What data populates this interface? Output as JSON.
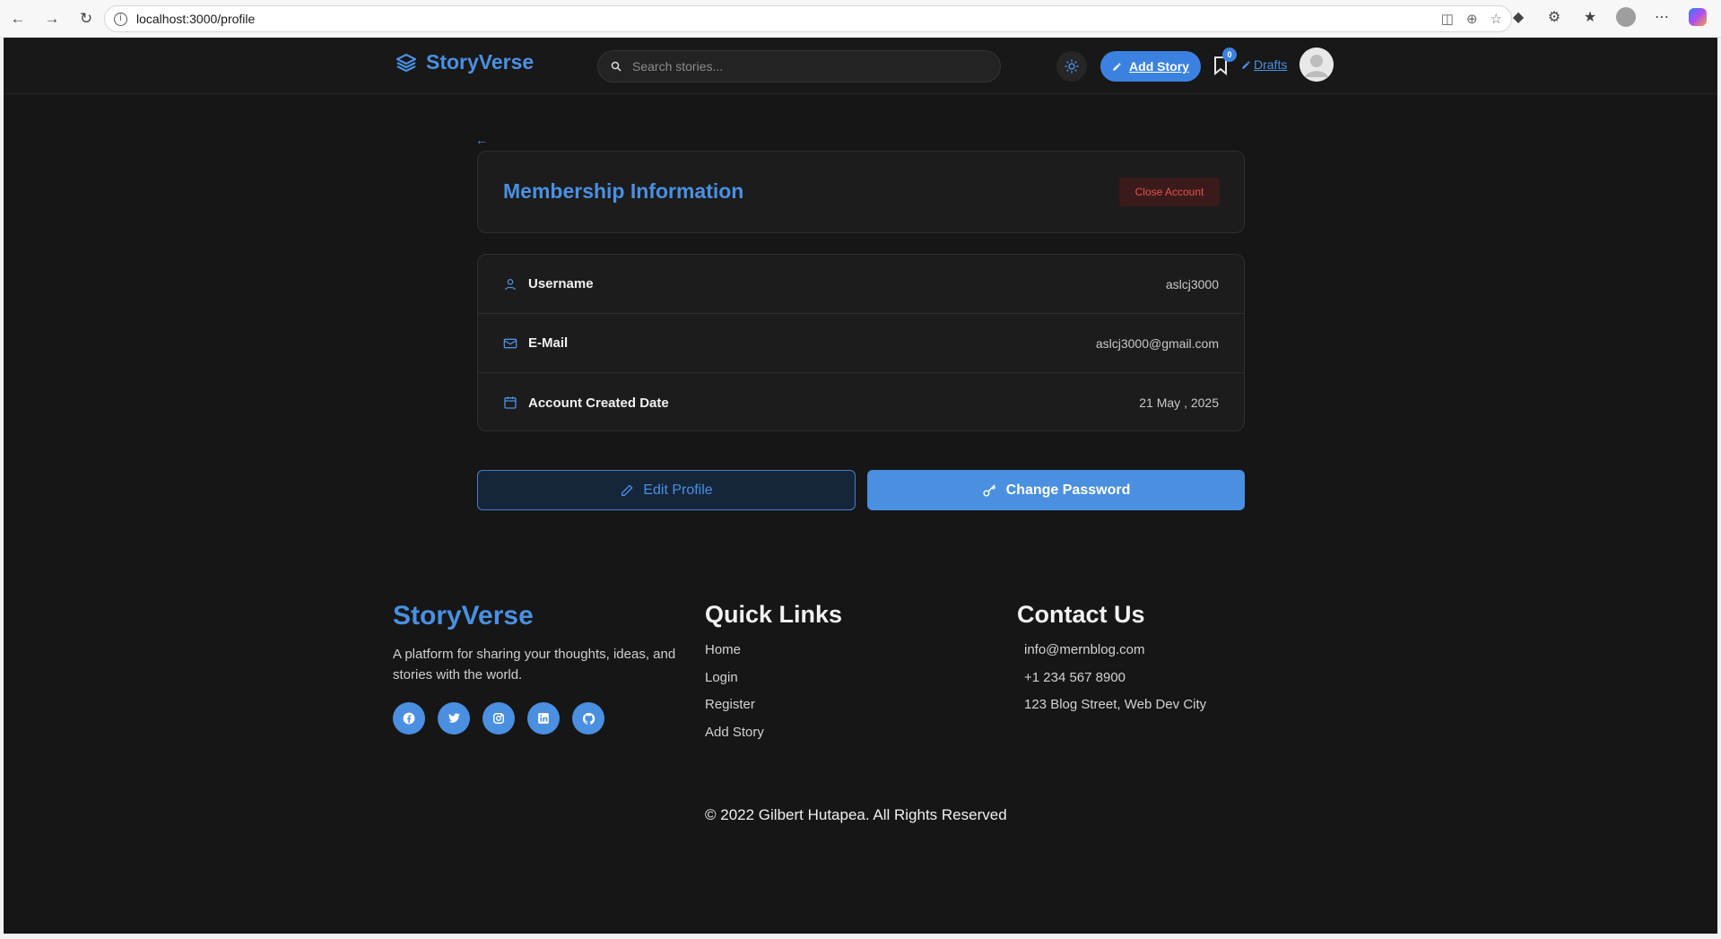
{
  "browser": {
    "url": "localhost:3000/profile"
  },
  "navbar": {
    "brand": "StoryVerse",
    "search_placeholder": "Search stories...",
    "add_story_label": "Add Story",
    "bookmark_count": "0",
    "drafts_label": "Drafts"
  },
  "membership": {
    "title": "Membership Information",
    "close_account_label": "Close Account",
    "rows": [
      {
        "label": "Username",
        "value": "aslcj3000",
        "icon": "user-icon"
      },
      {
        "label": "E-Mail",
        "value": "aslcj3000@gmail.com",
        "icon": "mail-icon"
      },
      {
        "label": "Account Created Date",
        "value": "21 May , 2025",
        "icon": "calendar-icon"
      }
    ]
  },
  "actions": {
    "edit_profile_label": "Edit Profile",
    "change_password_label": "Change Password"
  },
  "footer": {
    "brand": "StoryVerse",
    "description": "A platform for sharing your thoughts, ideas, and stories with the world.",
    "socials": [
      "facebook-icon",
      "twitter-icon",
      "instagram-icon",
      "linkedin-icon",
      "github-icon"
    ],
    "quick_links_title": "Quick Links",
    "quick_links": [
      "Home",
      "Login",
      "Register",
      "Add Story"
    ],
    "contact_title": "Contact Us",
    "contact": [
      "info@mernblog.com",
      "+1 234 567 8900",
      "123 Blog Street, Web Dev City"
    ],
    "copyright": "© 2022 Gilbert Hutapea. All Rights Reserved"
  },
  "colors": {
    "accent": "#4a90e2",
    "background": "#161616",
    "card": "#1c1c1c",
    "danger": "#e5534b"
  }
}
